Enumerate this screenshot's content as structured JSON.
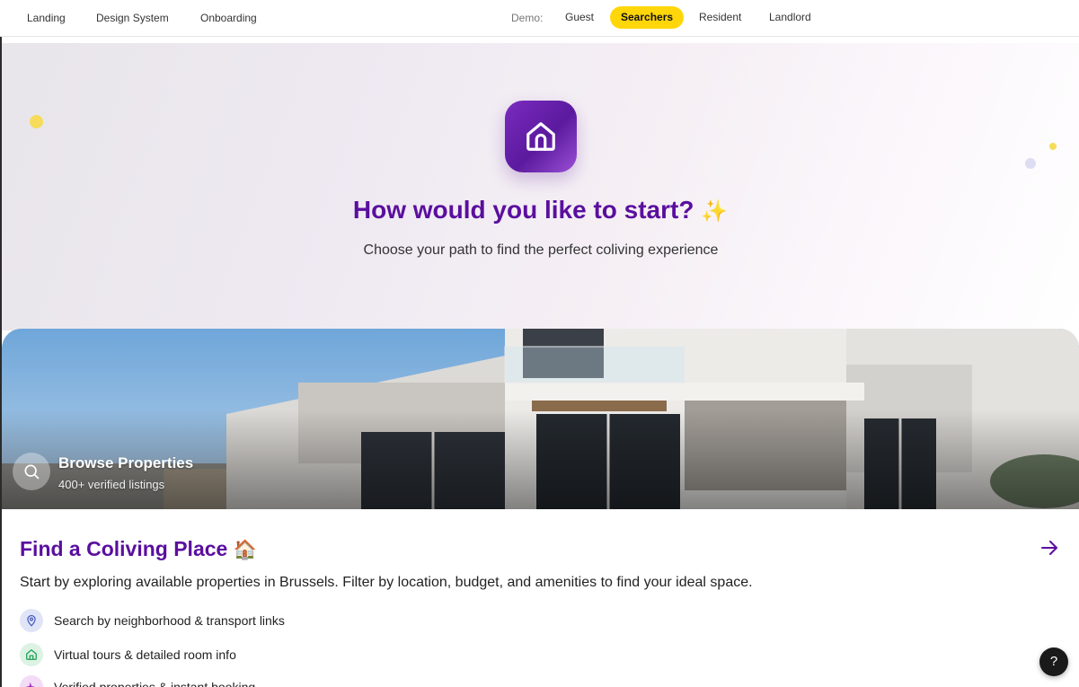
{
  "nav": {
    "links": [
      "Landing",
      "Design System",
      "Onboarding"
    ],
    "demo_label": "Demo:",
    "demo_pills": [
      {
        "label": "Guest",
        "active": false
      },
      {
        "label": "Searchers",
        "active": true
      },
      {
        "label": "Resident",
        "active": false
      },
      {
        "label": "Landlord",
        "active": false
      }
    ],
    "accent_color": "#ffd60a"
  },
  "hero": {
    "icon": "home-icon",
    "title": "How would you like to start?",
    "title_emoji": "✨",
    "subtitle": "Choose your path to find the perfect coliving experience",
    "title_color": "#5a0f9e"
  },
  "card": {
    "photo_badge_icon": "search-icon",
    "photo_title": "Browse Properties",
    "photo_subtitle": "400+ verified listings",
    "title": "Find a Coliving Place",
    "title_emoji": "🏠",
    "arrow_icon": "arrow-right-icon",
    "description": "Start by exploring available properties in Brussels. Filter by location, budget, and amenities to find your ideal space.",
    "features": [
      {
        "icon": "map-pin-icon",
        "text": "Search by neighborhood & transport links"
      },
      {
        "icon": "home-icon",
        "text": "Virtual tours & detailed room info"
      },
      {
        "icon": "sparkle-icon",
        "text": "Verified properties & instant booking"
      }
    ]
  },
  "help": {
    "label": "?",
    "icon": "help-icon"
  }
}
